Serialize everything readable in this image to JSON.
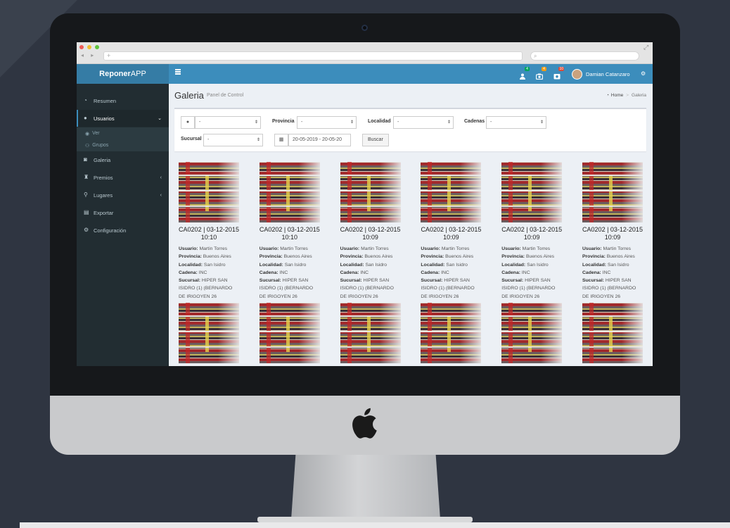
{
  "app": {
    "brand_bold": "Reponer",
    "brand_light": "APP",
    "url_placeholder": "+"
  },
  "topbar": {
    "badges": [
      "4",
      "4",
      "10"
    ],
    "user_name": "Damian Catanzaro"
  },
  "sidebar": {
    "items": [
      {
        "label": "Resumen",
        "icon": "dashboard-icon"
      },
      {
        "label": "Usuarios",
        "icon": "user-icon"
      },
      {
        "label": "Galeria",
        "icon": "camera-icon"
      },
      {
        "label": "Premios",
        "icon": "trophy-icon"
      },
      {
        "label": "Lugares",
        "icon": "map-marker-icon"
      },
      {
        "label": "Exportar",
        "icon": "file-export-icon"
      },
      {
        "label": "Configuración",
        "icon": "gears-icon"
      }
    ],
    "subitems": [
      {
        "label": "Ver",
        "icon": "eye-icon"
      },
      {
        "label": "Grupos",
        "icon": "users-icon"
      }
    ]
  },
  "page": {
    "title": "Galeria",
    "subtitle": "Panel de Control",
    "breadcrumb_home": "Home",
    "breadcrumb_current": "Galeria"
  },
  "filters": {
    "usuario_value": "-",
    "provincia_label": "Provincia",
    "provincia_value": "-",
    "localidad_label": "Localidad",
    "localidad_value": "-",
    "cadenas_label": "Cadenas",
    "cadenas_value": "-",
    "sucursal_label": "Sucursal",
    "sucursal_value": "-",
    "date_range": "20-05-2019 - 20-05-20",
    "search_button": "Buscar"
  },
  "gallery": {
    "labels": {
      "usuario": "Usuario:",
      "provincia": "Provincia:",
      "localidad": "Localidad:",
      "cadena": "Cadena:",
      "sucursal": "Sucursal:"
    },
    "cards": [
      {
        "title": "CA0202 | 03-12-2015 10:10",
        "usuario": "Martin Torres",
        "provincia": "Buenos Aires",
        "localidad": "San Isidro",
        "cadena": "INC",
        "sucursal": "HIPER SAN ISIDRO (1) (BERNARDO DE IRIGOYEN 26"
      },
      {
        "title": "CA0202 | 03-12-2015 10:10",
        "usuario": "Martin Torres",
        "provincia": "Buenos Aires",
        "localidad": "San Isidro",
        "cadena": "INC",
        "sucursal": "HIPER SAN ISIDRO (1) (BERNARDO DE IRIGOYEN 26"
      },
      {
        "title": "CA0202 | 03-12-2015 10:09",
        "usuario": "Martin Torres",
        "provincia": "Buenos Aires",
        "localidad": "San Isidro",
        "cadena": "INC",
        "sucursal": "HIPER SAN ISIDRO (1) (BERNARDO DE IRIGOYEN 26"
      },
      {
        "title": "CA0202 | 03-12-2015 10:09",
        "usuario": "Martin Torres",
        "provincia": "Buenos Aires",
        "localidad": "San Isidro",
        "cadena": "INC",
        "sucursal": "HIPER SAN ISIDRO (1) (BERNARDO DE IRIGOYEN 26"
      },
      {
        "title": "CA0202 | 03-12-2015 10:09",
        "usuario": "Martin Torres",
        "provincia": "Buenos Aires",
        "localidad": "San Isidro",
        "cadena": "INC",
        "sucursal": "HIPER SAN ISIDRO (1) (BERNARDO DE IRIGOYEN 26"
      },
      {
        "title": "CA0202 | 03-12-2015 10:09",
        "usuario": "Martin Torres",
        "provincia": "Buenos Aires",
        "localidad": "San Isidro",
        "cadena": "INC",
        "sucursal": "HIPER SAN ISIDRO (1) (BERNARDO DE IRIGOYEN 26"
      }
    ]
  },
  "colors": {
    "header": "#3c8dbc",
    "brand": "#357ca5",
    "sidebar": "#222d32",
    "content_bg": "#ecf0f5"
  }
}
